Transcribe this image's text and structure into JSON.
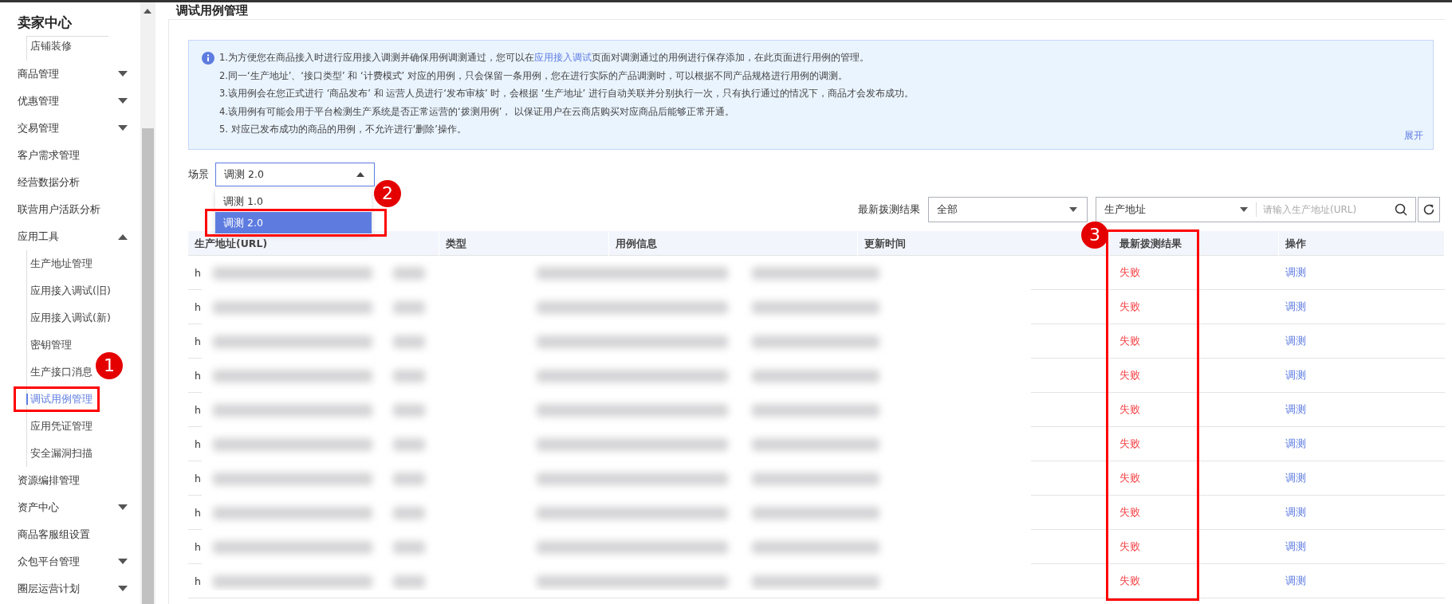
{
  "sidebar": {
    "title": "卖家中心",
    "items": [
      {
        "children": [
          {
            "label": "店铺装修",
            "selected": false
          }
        ]
      },
      {
        "label": "商品管理",
        "expanded": false,
        "selected": false
      },
      {
        "label": "优惠管理",
        "expanded": false,
        "selected": false
      },
      {
        "label": "交易管理",
        "expanded": false,
        "selected": false
      },
      {
        "label": "客户需求管理",
        "selected": false
      },
      {
        "label": "经营数据分析",
        "selected": false
      },
      {
        "label": "联营用户活跃分析",
        "selected": false
      },
      {
        "label": "应用工具",
        "expanded": true,
        "selected": false,
        "children": [
          {
            "label": "生产地址管理",
            "selected": false
          },
          {
            "label": "应用接入调试(旧)",
            "selected": false
          },
          {
            "label": "应用接入调试(新)",
            "selected": false
          },
          {
            "label": "密钥管理",
            "selected": false
          },
          {
            "label": "生产接口消息",
            "selected": false
          },
          {
            "label": "调试用例管理",
            "selected": true
          },
          {
            "label": "应用凭证管理",
            "selected": false
          },
          {
            "label": "安全漏洞扫描",
            "selected": false
          }
        ]
      },
      {
        "label": "资源编排管理",
        "selected": false
      },
      {
        "label": "资产中心",
        "expanded": false,
        "selected": false
      },
      {
        "label": "商品客服组设置",
        "selected": false
      },
      {
        "label": "众包平台管理",
        "expanded": false,
        "selected": false
      },
      {
        "label": "圈层运营计划",
        "expanded": false,
        "selected": false
      }
    ]
  },
  "page_title": "调试用例管理",
  "notice": {
    "first_line": {
      "before": "1.为方便您在商品接入时进行应用接入调测并确保用例调测通过，您可以在",
      "link": "应用接入调试",
      "after": "页面对调测通过的用例进行保存添加，在此页面进行用例的管理。"
    },
    "lines": [
      "2.同一‘生产地址’、‘接口类型’ 和 ‘计费模式’ 对应的用例，只会保留一条用例，您在进行实际的产品调测时，可以根据不同产品规格进行用例的调测。",
      "3.该用例会在您正式进行 ‘商品发布’ 和 运营人员进行‘发布审核’ 时，会根据 ‘生产地址’ 进行自动关联并分别执行一次，只有执行通过的情况下，商品才会发布成功。",
      "4.该用例有可能会用于平台检测生产系统是否正常运营的‘拨测用例’， 以保证用户在云商店购买对应商品后能够正常开通。",
      "5. 对应已发布成功的商品的用例，不允许进行‘删除’操作。"
    ],
    "expand_label": "展开"
  },
  "scene": {
    "label": "场景",
    "value": "调测 2.0",
    "open": true,
    "options": [
      {
        "label": "调测 1.0",
        "selected": false
      },
      {
        "label": "调测 2.0",
        "selected": true
      }
    ]
  },
  "filters": {
    "result_label": "最新拨测结果",
    "result_value": "全部",
    "field_value": "生产地址",
    "search_placeholder": "请输入生产地址(URL)"
  },
  "table": {
    "columns": [
      "生产地址(URL)",
      "类型",
      "用例信息",
      "更新时间",
      "最新拨测结果",
      "操作"
    ],
    "rows": [
      {
        "url": "h",
        "result": "失败",
        "failed": true,
        "action": "调测"
      },
      {
        "url": "h",
        "result": "失败",
        "failed": true,
        "action": "调测"
      },
      {
        "url": "h",
        "result": "失败",
        "failed": true,
        "action": "调测"
      },
      {
        "url": "h",
        "result": "失败",
        "failed": true,
        "action": "调测"
      },
      {
        "url": "h",
        "result": "失败",
        "failed": true,
        "action": "调测"
      },
      {
        "url": "h",
        "result": "失败",
        "failed": true,
        "action": "调测"
      },
      {
        "url": "h",
        "result": "失败",
        "failed": true,
        "action": "调测"
      },
      {
        "url": "h",
        "result": "失败",
        "failed": true,
        "action": "调测"
      },
      {
        "url": "h",
        "result": "失败",
        "failed": true,
        "action": "调测"
      },
      {
        "url": "h",
        "result": "失败",
        "failed": true,
        "action": "调测"
      }
    ]
  },
  "annotations": [
    {
      "label": "1"
    },
    {
      "label": "2"
    },
    {
      "label": "3"
    }
  ]
}
